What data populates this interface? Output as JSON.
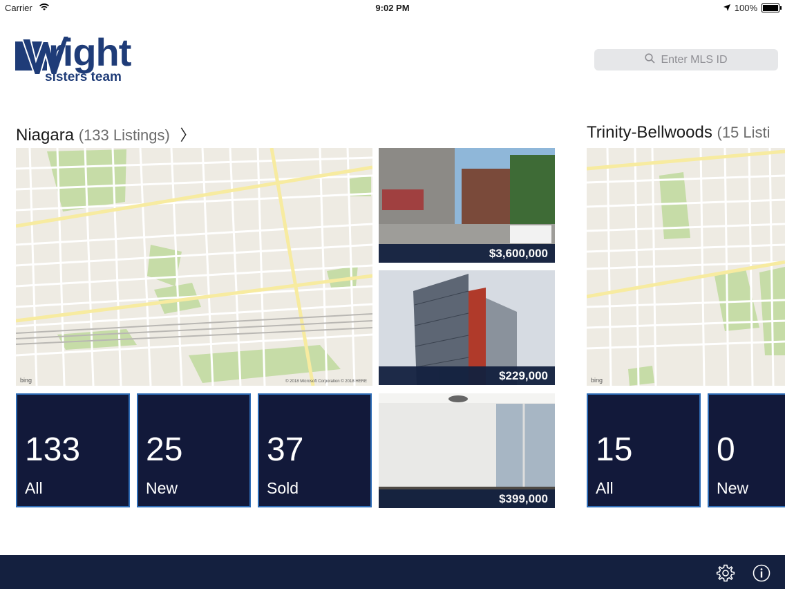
{
  "status_bar": {
    "carrier": "Carrier",
    "time": "9:02 PM",
    "battery": "100%"
  },
  "logo": {
    "word": "right",
    "sub": "sisters team"
  },
  "search": {
    "placeholder": "Enter MLS ID",
    "icon": "search-icon"
  },
  "sections": [
    {
      "name": "Niagara",
      "count": "(133 Listings)",
      "map_attribution": "bing",
      "map_copyright": "© 2018 Microsoft Corporation © 2018 HERE",
      "listings": [
        {
          "price": "$3,600,000"
        },
        {
          "price": "$229,000"
        },
        {
          "price": "$399,000"
        }
      ],
      "stats": [
        {
          "value": "133",
          "label": "All"
        },
        {
          "value": "25",
          "label": "New"
        },
        {
          "value": "37",
          "label": "Sold"
        }
      ]
    },
    {
      "name": "Trinity-Bellwoods",
      "count": "(15 Listi",
      "map_attribution": "bing",
      "stats": [
        {
          "value": "15",
          "label": "All"
        },
        {
          "value": "0",
          "label": "New"
        }
      ]
    }
  ],
  "footer": {
    "icons": [
      "gear-icon",
      "info-icon"
    ]
  },
  "colors": {
    "brand_navy": "#1f3c78",
    "tile_bg": "#12193a",
    "tile_border": "#2e6db7",
    "footer_bg": "#14203f"
  }
}
